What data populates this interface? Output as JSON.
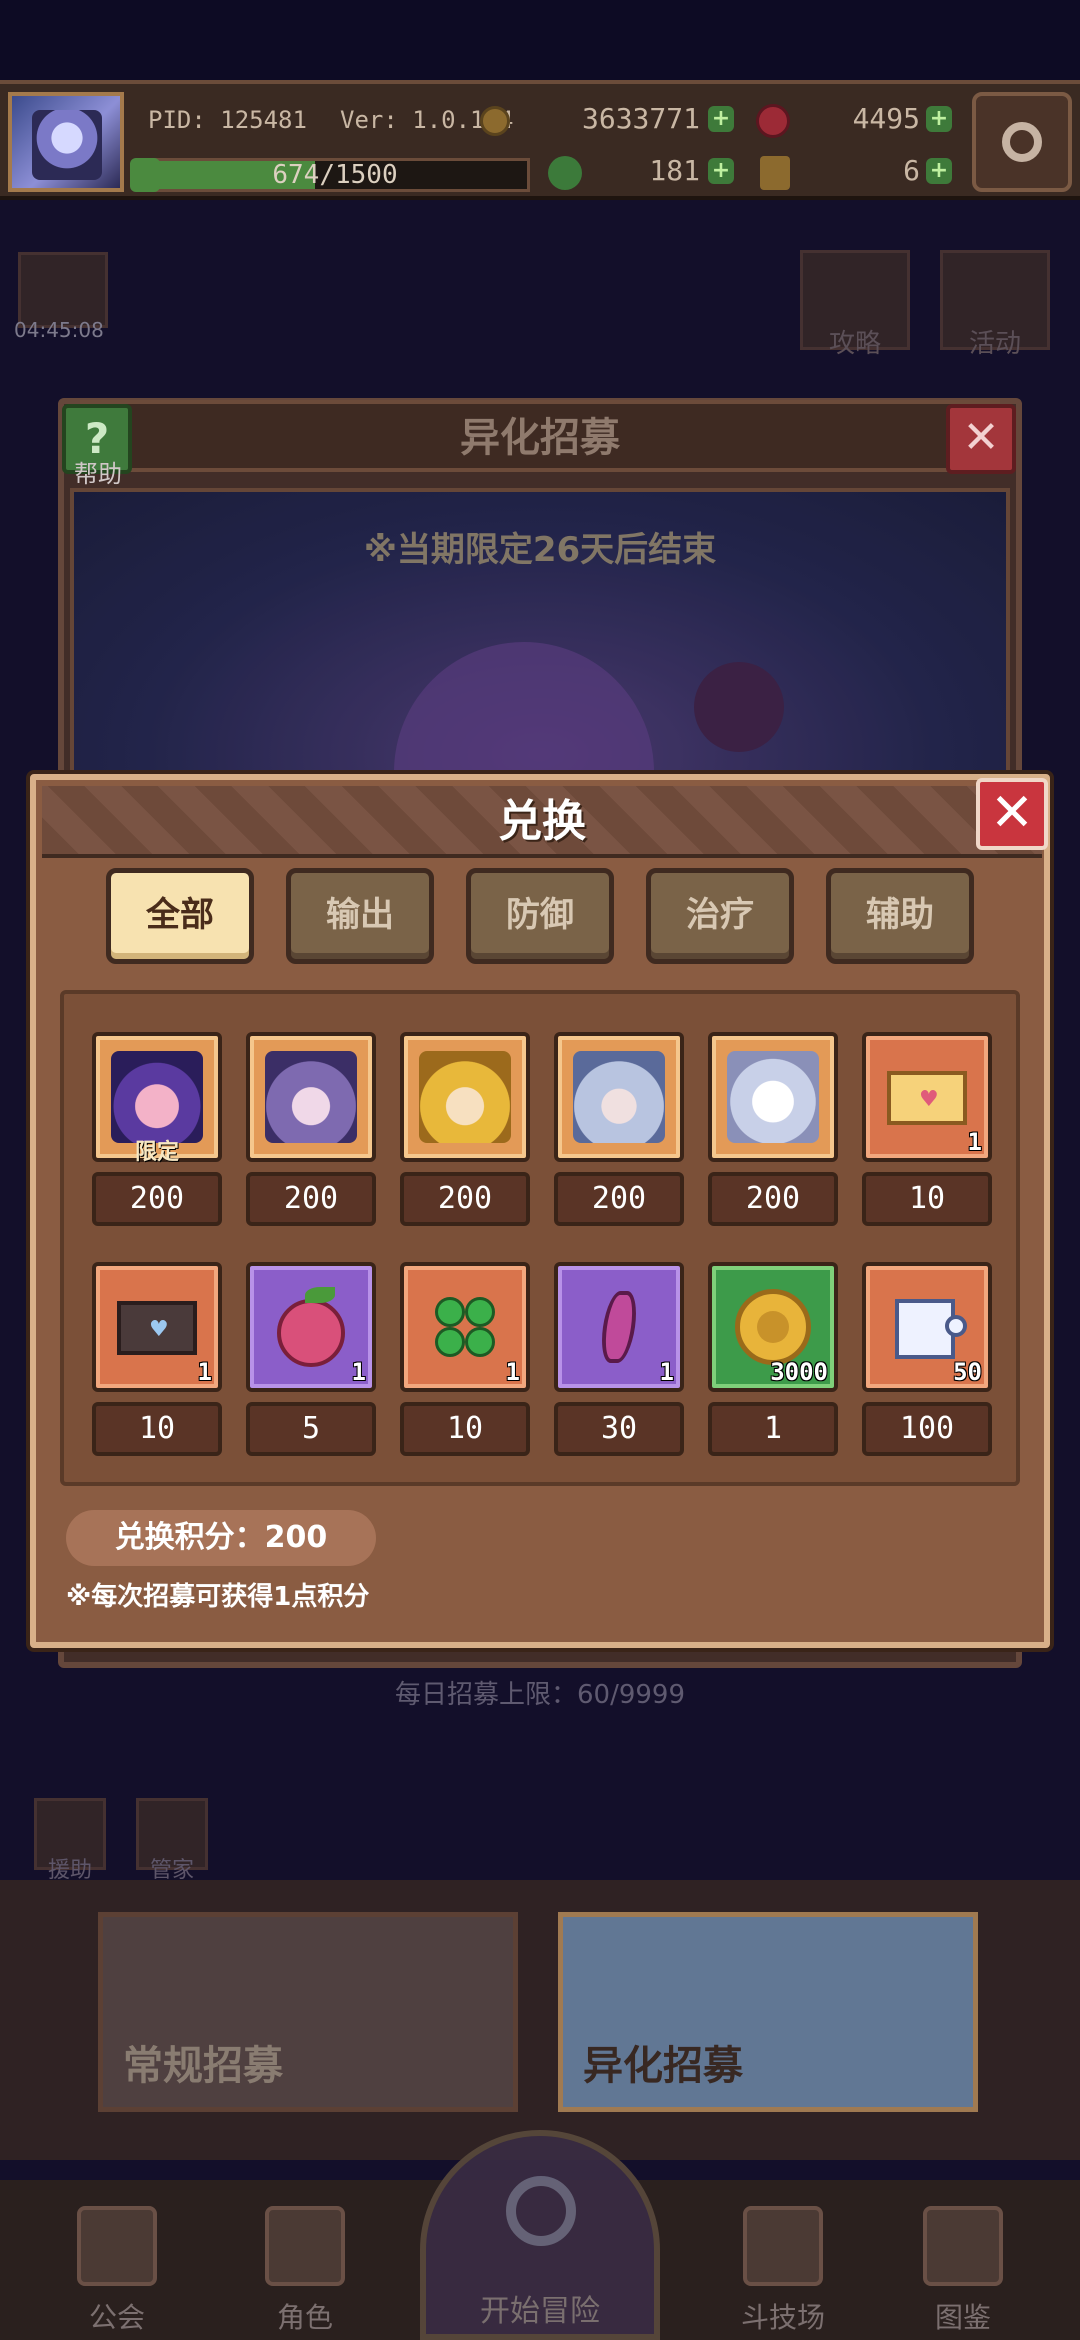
{
  "topbar": {
    "pid": "PID: 125481",
    "version": "Ver: 1.0.1.4",
    "gold": "3633771",
    "gems": "4495",
    "clover": "181",
    "tickets": "6",
    "exp": "674/1500",
    "exp_fraction": 0.449
  },
  "background": {
    "timer": "04:45:08",
    "guide_label": "攻略",
    "event_label": "活动",
    "recruit_title": "异化招募",
    "help_label": "帮助",
    "banner_text": "※当期限定26天后结束",
    "daily_limit": "每日招募上限：60/9999",
    "mini_btn_1": "援助",
    "mini_btn_2": "管家",
    "normal_recruit": "常规招募",
    "alien_recruit": "异化招募"
  },
  "nav": {
    "guild": "公会",
    "character": "角色",
    "start": "开始冒险",
    "arena": "斗技场",
    "codex": "图鉴"
  },
  "exchange": {
    "title": "兑换",
    "tabs": [
      "全部",
      "输出",
      "防御",
      "治疗",
      "辅助"
    ],
    "active_tab": 0,
    "limited_tag": "限定",
    "items": [
      {
        "name": "hero-witch-icon",
        "cost": "200",
        "qty": "",
        "limited": true,
        "bg": "hero"
      },
      {
        "name": "hero-purple-hair-icon",
        "cost": "200",
        "qty": "",
        "limited": false,
        "bg": "hero"
      },
      {
        "name": "hero-blonde-icon",
        "cost": "200",
        "qty": "",
        "limited": false,
        "bg": "hero"
      },
      {
        "name": "hero-silver-armor-icon",
        "cost": "200",
        "qty": "",
        "limited": false,
        "bg": "hero"
      },
      {
        "name": "hero-white-hair-icon",
        "cost": "200",
        "qty": "",
        "limited": false,
        "bg": "hero"
      },
      {
        "name": "love-letter-icon",
        "cost": "10",
        "qty": "1",
        "limited": false,
        "bg": "orange"
      },
      {
        "name": "dark-letter-icon",
        "cost": "10",
        "qty": "1",
        "limited": false,
        "bg": "orange"
      },
      {
        "name": "pink-fruit-icon",
        "cost": "5",
        "qty": "1",
        "limited": false,
        "bg": "purple"
      },
      {
        "name": "four-leaf-clover-icon",
        "cost": "10",
        "qty": "1",
        "limited": false,
        "bg": "orange"
      },
      {
        "name": "purple-crystal-icon",
        "cost": "30",
        "qty": "1",
        "limited": false,
        "bg": "purple"
      },
      {
        "name": "gold-coin-icon",
        "cost": "1",
        "qty": "3000",
        "limited": false,
        "bg": "green"
      },
      {
        "name": "puzzle-piece-icon",
        "cost": "100",
        "qty": "50",
        "limited": false,
        "bg": "orange"
      }
    ],
    "points": "兑换积分：200",
    "note": "※每次招募可获得1点积分"
  }
}
